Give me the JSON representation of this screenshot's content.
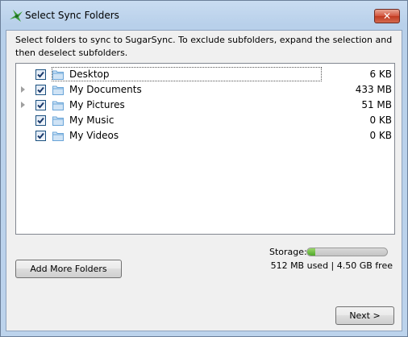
{
  "window": {
    "title": "Select Sync Folders",
    "close_label": "✕"
  },
  "instructions": "Select folders to sync to SugarSync. To exclude subfolders, expand the selection and then deselect subfolders.",
  "folders": [
    {
      "label": "Desktop",
      "size": "6 KB",
      "checked": true,
      "expandable": false,
      "focused": true
    },
    {
      "label": "My Documents",
      "size": "433 MB",
      "checked": true,
      "expandable": true,
      "focused": false
    },
    {
      "label": "My Pictures",
      "size": "51 MB",
      "checked": true,
      "expandable": true,
      "focused": false
    },
    {
      "label": "My Music",
      "size": "0 KB",
      "checked": true,
      "expandable": false,
      "focused": false
    },
    {
      "label": "My Videos",
      "size": "0 KB",
      "checked": true,
      "expandable": false,
      "focused": false
    }
  ],
  "storage": {
    "label": "Storage:",
    "usage_text": "512 MB used | 4.50 GB free",
    "used_fraction": 0.1
  },
  "buttons": {
    "add_more": "Add More Folders",
    "next": "Next >"
  },
  "icons": {
    "app": "sugarsync-logo-icon",
    "folder": "folder-icon",
    "expander": "expand-triangle-icon",
    "checkbox": "checkmark-icon"
  },
  "colors": {
    "folder": "#6aa5d8",
    "storage_fill": "#4fa82a",
    "checkmark": "#1a3a6b"
  }
}
